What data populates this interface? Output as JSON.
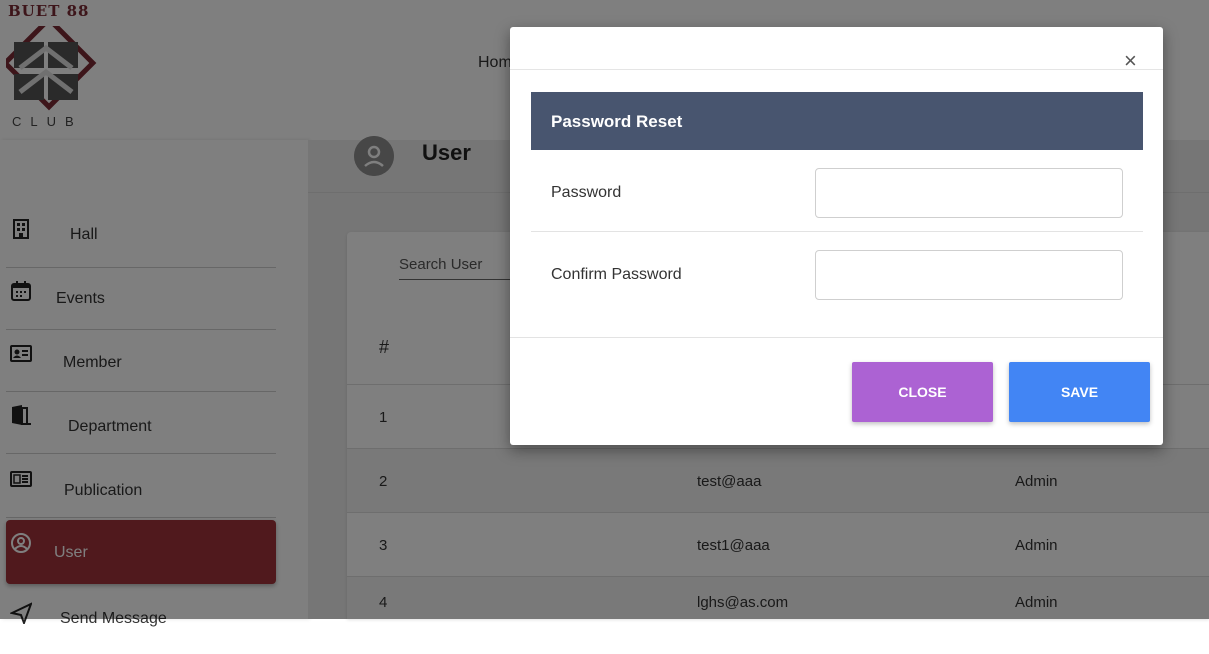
{
  "brand": {
    "title": "BUET 88",
    "subtitle": "CLUB"
  },
  "nav": {
    "home_label": "Home"
  },
  "sidebar": {
    "items": [
      {
        "label": "Hall",
        "icon": "building-icon"
      },
      {
        "label": "Events",
        "icon": "calendar-icon"
      },
      {
        "label": "Member",
        "icon": "id-card-icon"
      },
      {
        "label": "Department",
        "icon": "door-icon"
      },
      {
        "label": "Publication",
        "icon": "newspaper-icon"
      },
      {
        "label": "User",
        "icon": "user-circle-icon",
        "active": true
      },
      {
        "label": "Send Message",
        "icon": "paper-plane-icon"
      }
    ]
  },
  "page": {
    "title": "User"
  },
  "search": {
    "placeholder": "Search User"
  },
  "table": {
    "headers": [
      "#"
    ],
    "rows": [
      {
        "num": "1",
        "email": "",
        "role": ""
      },
      {
        "num": "2",
        "email": "test@aaa",
        "role": "Admin"
      },
      {
        "num": "3",
        "email": "test1@aaa",
        "role": "Admin"
      },
      {
        "num": "4",
        "email": "lghs@as.com",
        "role": "Admin"
      }
    ]
  },
  "modal": {
    "title": "Password Reset",
    "close_symbol": "×",
    "fields": {
      "password_label": "Password",
      "password_value": "",
      "confirm_label": "Confirm Password",
      "confirm_value": ""
    },
    "buttons": {
      "close_label": "CLOSE",
      "save_label": "SAVE"
    }
  },
  "colors": {
    "sidebar_active": "#a0333b",
    "modal_header": "#48556f",
    "close_button": "#ac62d3",
    "save_button": "#4285f4",
    "brand": "#7a2b35"
  }
}
